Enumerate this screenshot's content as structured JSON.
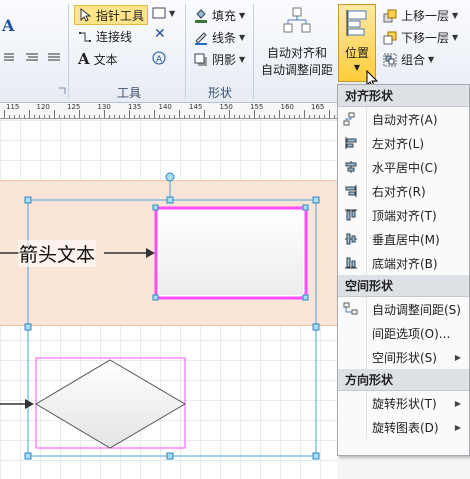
{
  "ribbon": {
    "font_glyph": "A",
    "tools_group": {
      "label": "工具",
      "pointer_tool": "指针工具",
      "connector": "连接线",
      "text": "文本"
    },
    "shape_group": {
      "label": "形状",
      "fill": "填充",
      "line": "线条",
      "shadow": "阴影"
    },
    "auto_align_button": {
      "line1": "自动对齐和",
      "line2": "自动调整间距"
    },
    "position_button": "位置",
    "bring_forward": "上移一层",
    "send_backward": "下移一层",
    "group": "组合"
  },
  "ruler": {
    "labels": [
      "115",
      "120",
      "125",
      "130",
      "135",
      "140",
      "145",
      "150",
      "155",
      "160",
      "165"
    ]
  },
  "canvas": {
    "arrow_text": "箭头文本"
  },
  "menu": {
    "sections": [
      {
        "header": "对齐形状",
        "items": [
          {
            "label": "自动对齐(A)",
            "icon": "auto-align-icon",
            "submenu": false
          },
          {
            "label": "左对齐(L)",
            "icon": "align-left-icon",
            "submenu": false
          },
          {
            "label": "水平居中(C)",
            "icon": "align-center-icon",
            "submenu": false
          },
          {
            "label": "右对齐(R)",
            "icon": "align-right-icon",
            "submenu": false
          },
          {
            "label": "顶端对齐(T)",
            "icon": "align-top-icon",
            "submenu": false
          },
          {
            "label": "垂直居中(M)",
            "icon": "align-middle-icon",
            "submenu": false
          },
          {
            "label": "底端对齐(B)",
            "icon": "align-bottom-icon",
            "submenu": false
          }
        ]
      },
      {
        "header": "空间形状",
        "items": [
          {
            "label": "自动调整间距(S)",
            "icon": "auto-space-icon",
            "submenu": false
          },
          {
            "label": "间距选项(O)...",
            "icon": "",
            "submenu": false
          },
          {
            "label": "空间形状(S)",
            "icon": "",
            "submenu": true
          }
        ]
      },
      {
        "header": "方向形状",
        "items": [
          {
            "label": "旋转形状(T)",
            "icon": "",
            "submenu": true
          },
          {
            "label": "旋转图表(D)",
            "icon": "",
            "submenu": true
          }
        ]
      }
    ]
  },
  "colors": {
    "accent": "#ffd24a",
    "selection": "#4aa3d8",
    "highlight_border": "#ff4dff",
    "container_fill": "#fbe5d6"
  }
}
